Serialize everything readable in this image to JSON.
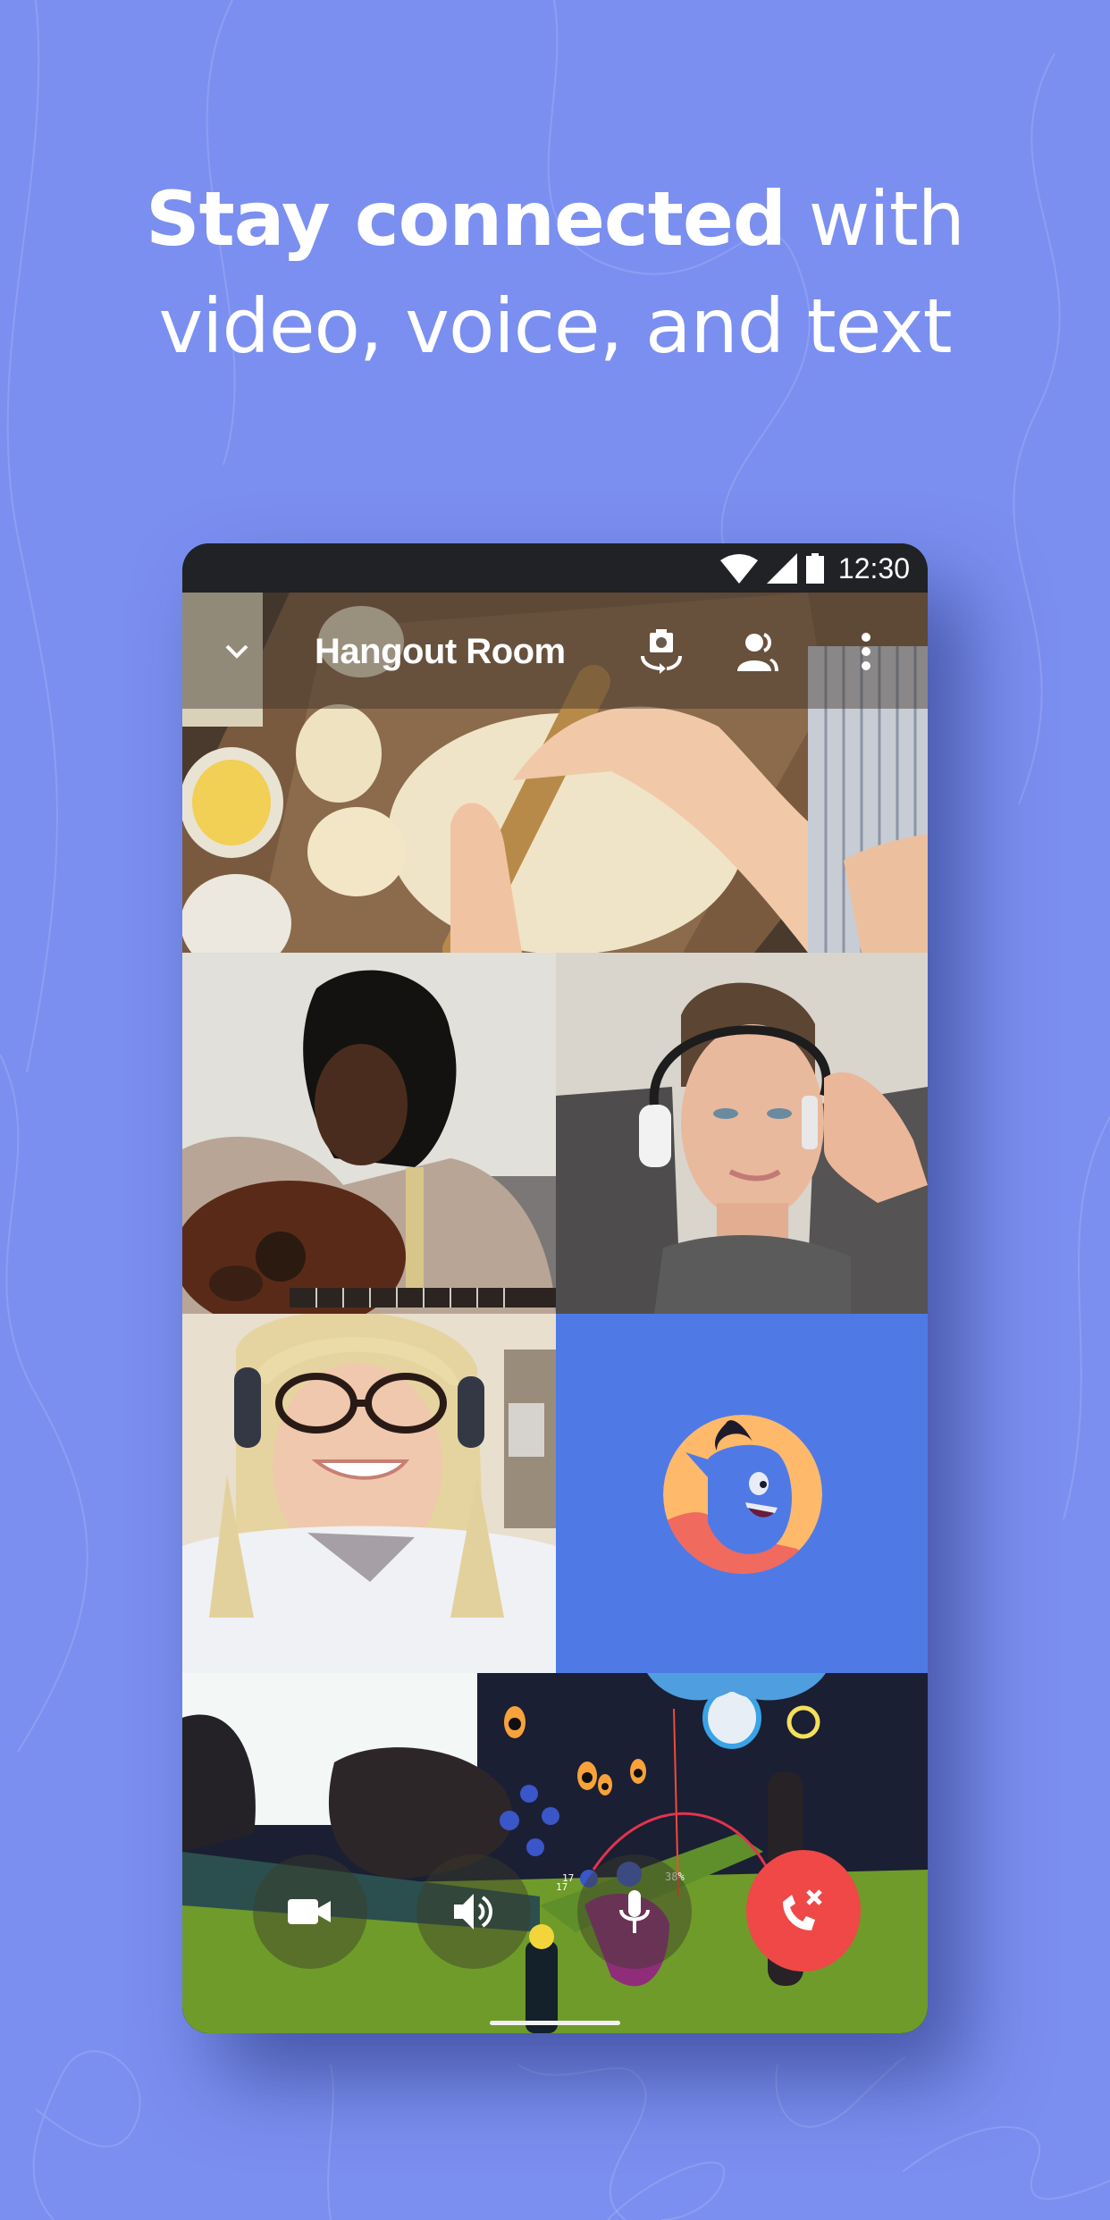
{
  "marketing": {
    "headline_bold": "Stay connected",
    "headline_regular": " with",
    "headline_line2": "video, voice, and text"
  },
  "status_bar": {
    "time": "12:30",
    "icons": [
      "wifi-icon",
      "cellular-signal-icon",
      "battery-icon"
    ]
  },
  "call_header": {
    "title": "Hangout Room",
    "icons": [
      "chevron-down-icon",
      "switch-camera-icon",
      "participants-icon",
      "more-options-icon"
    ]
  },
  "video_tiles": [
    {
      "name": "participant-baking",
      "type": "video"
    },
    {
      "name": "participant-guitar",
      "type": "video"
    },
    {
      "name": "participant-headphones",
      "type": "video"
    },
    {
      "name": "participant-glasses",
      "type": "video"
    },
    {
      "name": "participant-avatar",
      "type": "avatar"
    },
    {
      "name": "participant-game-stream",
      "type": "screen-share"
    }
  ],
  "game_hud": {
    "counter_a": "17",
    "counter_b": "17",
    "percent": "38%"
  },
  "call_controls": [
    {
      "name": "camera-toggle",
      "icon": "video-camera-icon"
    },
    {
      "name": "speaker-toggle",
      "icon": "speaker-icon"
    },
    {
      "name": "mic-toggle",
      "icon": "microphone-icon"
    },
    {
      "name": "end-call",
      "icon": "hang-up-icon"
    }
  ],
  "colors": {
    "background": "#7b8ff0",
    "avatar_tile": "#4f7ae6",
    "hangup": "#f04747",
    "status_bar": "#202225"
  }
}
